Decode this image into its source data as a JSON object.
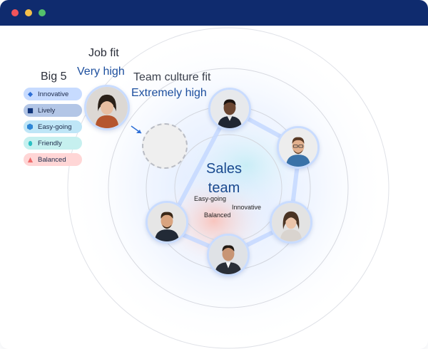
{
  "window": {
    "titlebar_color": "#0f2b6e",
    "controls": [
      "close",
      "minimize",
      "maximize"
    ]
  },
  "labels": {
    "job_fit": "Job fit",
    "job_fit_value": "Very high",
    "team_culture_fit": "Team culture fit",
    "team_culture_fit_value": "Extremely high",
    "big5": "Big 5"
  },
  "legend": [
    {
      "label": "Innovative",
      "icon": "diamond-icon",
      "bg": "#c7dbff",
      "color": "#2e6fd6"
    },
    {
      "label": "Lively",
      "icon": "square-icon",
      "bg": "#b3c6e6",
      "color": "#12357a"
    },
    {
      "label": "Easy-going",
      "icon": "hexagon-icon",
      "bg": "#bfe6f7",
      "color": "#2d86d6"
    },
    {
      "label": "Friendly",
      "icon": "circle-icon",
      "bg": "#c6f0ef",
      "color": "#2bc1c4"
    },
    {
      "label": "Balanced",
      "icon": "triangle-icon",
      "bg": "#ffd6d6",
      "color": "#ef6a6a"
    }
  ],
  "team": {
    "title_line1": "Sales",
    "title_line2": "team",
    "traits": [
      "Easy-going",
      "Innovative",
      "Balanced"
    ]
  },
  "colors": {
    "accent": "#1d4f9e",
    "ring": "#d9dbe2"
  }
}
